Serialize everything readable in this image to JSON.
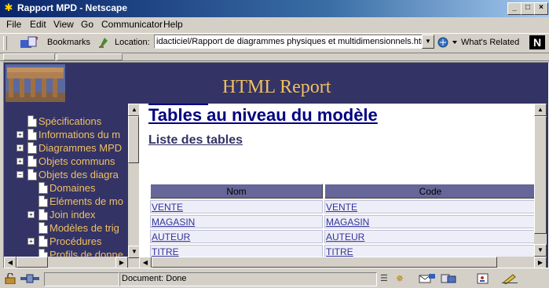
{
  "window": {
    "title": "Rapport MPD - Netscape"
  },
  "menu": [
    "File",
    "Edit",
    "View",
    "Go",
    "Communicator",
    "Help"
  ],
  "toolbar": {
    "bookmarks_label": "Bookmarks",
    "location_label": "Location:",
    "location_value": "idacticiel/Rapport de diagrammes physiques et multidimensionnels.htm",
    "whats_related_label": "What's Related"
  },
  "banner": {
    "title": "HTML Report"
  },
  "nav": {
    "items": [
      {
        "label": "Spécifications",
        "expander": "",
        "level": 0
      },
      {
        "label": "Informations du m",
        "expander": "+",
        "level": 0
      },
      {
        "label": "Diagrammes MPD",
        "expander": "+",
        "level": 0
      },
      {
        "label": "Objets communs",
        "expander": "+",
        "level": 0
      },
      {
        "label": "Objets des diagra",
        "expander": "−",
        "level": 0
      },
      {
        "label": "Domaines",
        "expander": "",
        "level": 1
      },
      {
        "label": "Eléments de mo",
        "expander": "",
        "level": 1
      },
      {
        "label": "Join index",
        "expander": "+",
        "level": 1
      },
      {
        "label": "Modèles de trig",
        "expander": "",
        "level": 1
      },
      {
        "label": "Procédures",
        "expander": "+",
        "level": 1
      },
      {
        "label": "Profils de donne",
        "expander": "",
        "level": 1
      }
    ]
  },
  "main": {
    "heading": "Tables au niveau du modèle",
    "subheading": "Liste des tables",
    "table": {
      "columns": [
        "Nom",
        "Code"
      ],
      "rows": [
        [
          "VENTE",
          "VENTE"
        ],
        [
          "MAGASIN",
          "MAGASIN"
        ],
        [
          "AUTEUR",
          "AUTEUR"
        ],
        [
          "TITRE",
          "TITRE"
        ]
      ]
    }
  },
  "status": {
    "text": "Document: Done"
  },
  "colors": {
    "frame_bg": "#333366",
    "link": "#333399",
    "nav_text": "#f0c060",
    "header_cell": "#666699"
  }
}
